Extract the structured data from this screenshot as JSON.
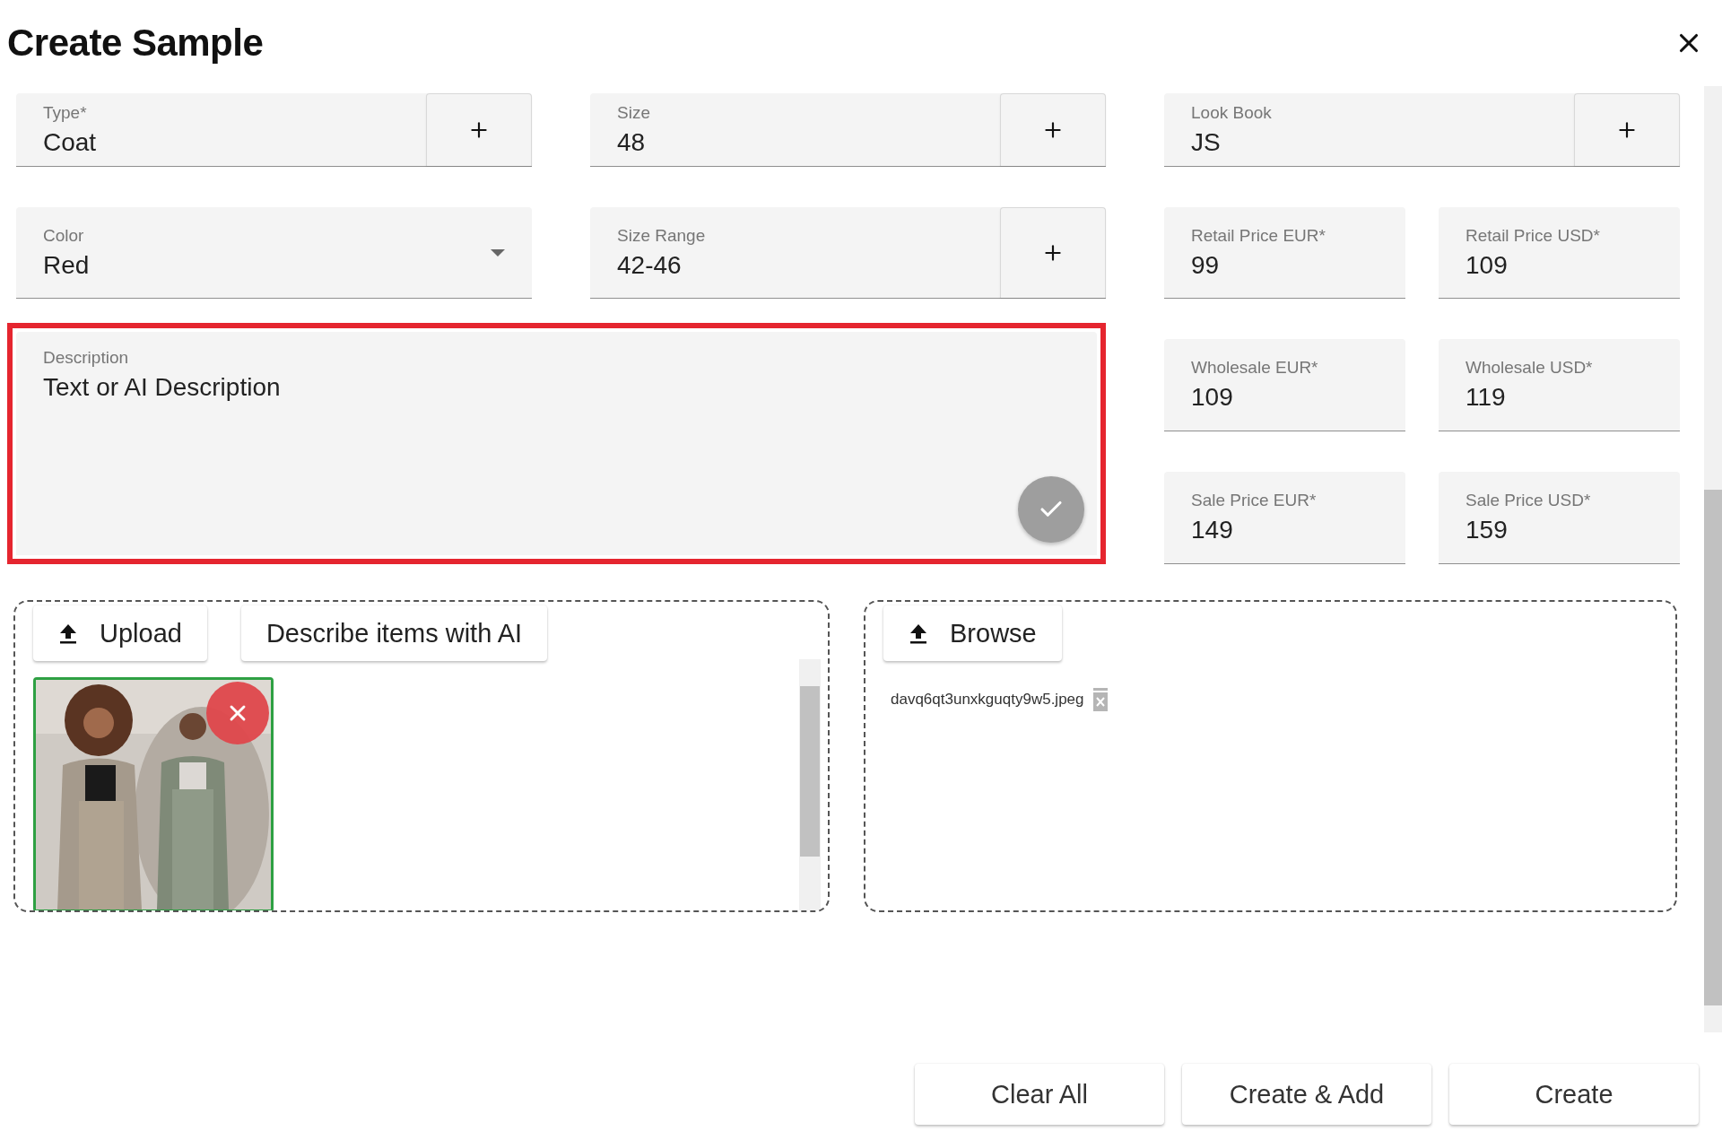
{
  "dialog": {
    "title": "Create Sample"
  },
  "fields": [
    {
      "label": "Type*",
      "value": "Coat",
      "kind": "add"
    },
    {
      "label": "Size",
      "value": "48",
      "kind": "add"
    },
    {
      "label": "Look Book",
      "value": "JS",
      "kind": "add"
    },
    {
      "label": "Color",
      "value": "Red",
      "kind": "select"
    },
    {
      "label": "Size Range",
      "value": "42-46",
      "kind": "add"
    }
  ],
  "prices": [
    {
      "label": "Retail Price EUR*",
      "value": "99"
    },
    {
      "label": "Retail Price USD*",
      "value": "109"
    },
    {
      "label": "Wholesale EUR*",
      "value": "109"
    },
    {
      "label": "Wholesale USD*",
      "value": "119"
    },
    {
      "label": "Sale Price EUR*",
      "value": "149"
    },
    {
      "label": "Sale Price USD*",
      "value": "159"
    }
  ],
  "description": {
    "label": "Description",
    "value": "Text or AI Description",
    "highlighted": true
  },
  "upload_panel": {
    "buttons": [
      {
        "label": "Upload",
        "kind": "upload"
      },
      {
        "label": "Describe items with AI",
        "kind": "plain"
      }
    ],
    "images": [
      {
        "kind": "picture",
        "selected": true
      }
    ]
  },
  "browse_panel": {
    "buttons": [
      {
        "label": "Browse",
        "kind": "upload"
      }
    ],
    "files": [
      {
        "name": "davq6qt3unxkguqty9w5.jpeg"
      }
    ]
  },
  "actions": [
    "Clear All",
    "Create & Add",
    "Create"
  ]
}
